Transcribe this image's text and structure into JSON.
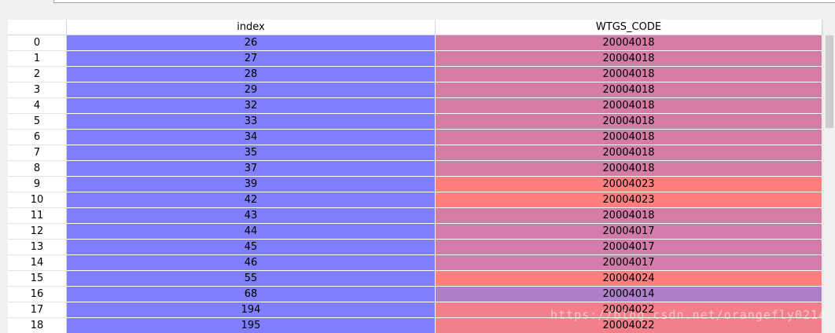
{
  "columns": {
    "index": "index",
    "code": "WTGS_CODE"
  },
  "colors": {
    "index_bg": "#7f7fff",
    "code_20004018": "#d57ba4",
    "code_20004023": "#ff7f7f",
    "code_20004017": "#d47ca9",
    "code_20004024": "#ff7f7f",
    "code_20004014": "#b07fcc",
    "code_20004022": "#f37f8a"
  },
  "rows": [
    {
      "label": "0",
      "index": "26",
      "code": "20004018",
      "color": "#d57ba4"
    },
    {
      "label": "1",
      "index": "27",
      "code": "20004018",
      "color": "#d57ba4"
    },
    {
      "label": "2",
      "index": "28",
      "code": "20004018",
      "color": "#d57ba4"
    },
    {
      "label": "3",
      "index": "29",
      "code": "20004018",
      "color": "#d57ba4"
    },
    {
      "label": "4",
      "index": "32",
      "code": "20004018",
      "color": "#d57ba4"
    },
    {
      "label": "5",
      "index": "33",
      "code": "20004018",
      "color": "#d57ba4"
    },
    {
      "label": "6",
      "index": "34",
      "code": "20004018",
      "color": "#d57ba4"
    },
    {
      "label": "7",
      "index": "35",
      "code": "20004018",
      "color": "#d57ba4"
    },
    {
      "label": "8",
      "index": "37",
      "code": "20004018",
      "color": "#d57ba4"
    },
    {
      "label": "9",
      "index": "39",
      "code": "20004023",
      "color": "#ff7f7f"
    },
    {
      "label": "10",
      "index": "42",
      "code": "20004023",
      "color": "#ff7f7f"
    },
    {
      "label": "11",
      "index": "43",
      "code": "20004018",
      "color": "#d57ba4"
    },
    {
      "label": "12",
      "index": "44",
      "code": "20004017",
      "color": "#d47ca9"
    },
    {
      "label": "13",
      "index": "45",
      "code": "20004017",
      "color": "#d47ca9"
    },
    {
      "label": "14",
      "index": "46",
      "code": "20004017",
      "color": "#d47ca9"
    },
    {
      "label": "15",
      "index": "55",
      "code": "20004024",
      "color": "#ff7f7f"
    },
    {
      "label": "16",
      "index": "68",
      "code": "20004014",
      "color": "#b07fcc"
    },
    {
      "label": "17",
      "index": "194",
      "code": "20004022",
      "color": "#f37f8a"
    },
    {
      "label": "18",
      "index": "195",
      "code": "20004022",
      "color": "#f37f8a"
    }
  ],
  "watermark": "https://blog.csdn.net/orangefly0214"
}
